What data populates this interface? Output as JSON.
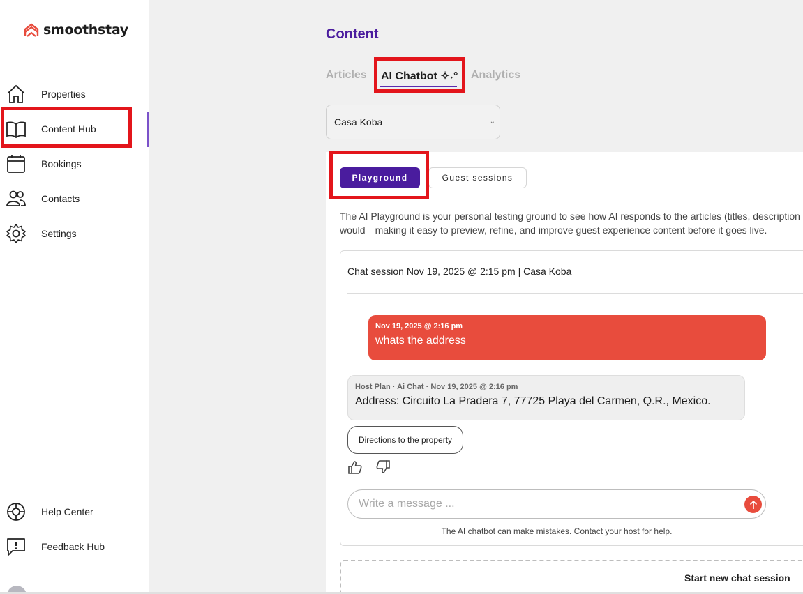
{
  "brand": {
    "name": "smoothstay",
    "accent": "#e84c3d",
    "primary": "#4a1c9e"
  },
  "sidebar": {
    "items": [
      {
        "label": "Properties",
        "icon": "home-icon"
      },
      {
        "label": "Content Hub",
        "icon": "book-icon",
        "active": true
      },
      {
        "label": "Bookings",
        "icon": "calendar-icon"
      },
      {
        "label": "Contacts",
        "icon": "users-icon"
      },
      {
        "label": "Settings",
        "icon": "gear-icon"
      }
    ],
    "footer_items": [
      {
        "label": "Help Center",
        "icon": "lifebuoy-icon"
      },
      {
        "label": "Feedback Hub",
        "icon": "feedback-icon"
      }
    ]
  },
  "page": {
    "title": "Content"
  },
  "tabs": [
    {
      "label": "Articles"
    },
    {
      "label": "AI Chatbot ✧˖°",
      "active": true
    },
    {
      "label": "Analytics"
    }
  ],
  "property_select": {
    "value": "Casa Koba"
  },
  "subtabs": [
    {
      "label": "Playground",
      "active": true
    },
    {
      "label": "Guest sessions"
    }
  ],
  "description": {
    "line1": "The AI Playground is your personal testing ground to see how AI responds to the articles (titles, description",
    "line2": "would—making it easy to preview, refine, and improve guest experience content before it goes live."
  },
  "chat": {
    "session_title": "Chat session Nov 19, 2025 @ 2:15 pm | Casa Koba",
    "user_message": {
      "meta": "Nov 19, 2025 @ 2:16 pm",
      "text": "whats the address"
    },
    "bot_message": {
      "meta": "Host Plan · Ai Chat · Nov 19, 2025 @ 2:16 pm",
      "text": "Address: Circuito La Pradera 7, 77725 Playa del Carmen, Q.R., Mexico."
    },
    "suggestion": "Directions to the property",
    "input_placeholder": "Write a message ...",
    "disclaimer": "The AI chatbot can make mistakes. Contact your host for help.",
    "new_session_label": "Start new chat session"
  }
}
